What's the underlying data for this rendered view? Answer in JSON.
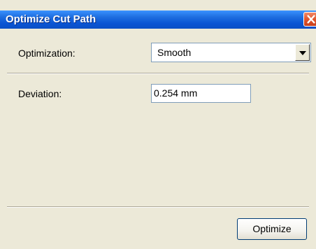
{
  "window": {
    "title": "Optimize Cut Path"
  },
  "optimization": {
    "label": "Optimization:",
    "selected": "Smooth"
  },
  "deviation": {
    "label": "Deviation:",
    "value": "0.254 mm"
  },
  "actions": {
    "optimize_label": "Optimize"
  },
  "colors": {
    "titlebar": "#0a55d4",
    "dialog_background": "#ece9d8",
    "close_button": "#e2552d"
  }
}
